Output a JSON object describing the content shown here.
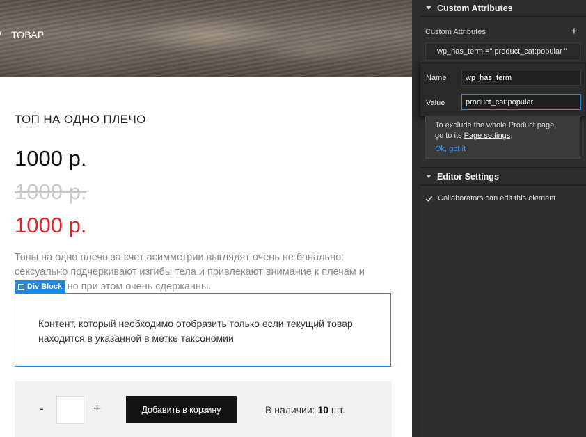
{
  "canvas": {
    "hero": {
      "left_mark": "/",
      "nav_label": "ТОВАР"
    },
    "product": {
      "title": "ТОП НА ОДНО ПЛЕЧО",
      "price_main": "1000 р.",
      "price_old": "1000 р.",
      "price_sale": "1000 р.",
      "description": "Топы на одно плечо за счет асимметрии выглядят очень не банально: сексуально подчеркивают изгибы тела и привлекают внимание к плечам и ключицам, но при этом очень сдержанны."
    },
    "div_block": {
      "tag_label": "Div Block",
      "text": "Контент, который необходимо отобразить только если текущий товар находится в указанной в метке таксономии"
    },
    "cart": {
      "minus": "-",
      "plus": "+",
      "quantity_value": "",
      "add_button": "Добавить в корзину",
      "stock_label": "В наличии:",
      "stock_count": "10",
      "stock_unit": "шт."
    }
  },
  "panel": {
    "custom_attributes": {
      "section_title": "Custom Attributes",
      "label": "Custom Attributes",
      "add_icon": "+",
      "attribute_summary": "wp_has_term =\" product_cat:popular \"",
      "popup": {
        "name_label": "Name",
        "name_value": "wp_has_term",
        "value_label": "Value",
        "value_value": "product_cat:popular"
      }
    },
    "info": {
      "line1": "To exclude the whole Product page,",
      "line2_prefix": "go to its ",
      "line2_link": "Page settings",
      "line2_suffix": ".",
      "ok_link": "Ok, got it"
    },
    "editor_settings": {
      "section_title": "Editor Settings",
      "collaborators_label": "Collaborators can edit this element",
      "collaborators_checked": true
    }
  },
  "colors": {
    "accent_blue": "#1f88e5",
    "sale_red": "#e0222a",
    "panel_bg": "#2e2e2e",
    "link_blue": "#3b94ef"
  }
}
